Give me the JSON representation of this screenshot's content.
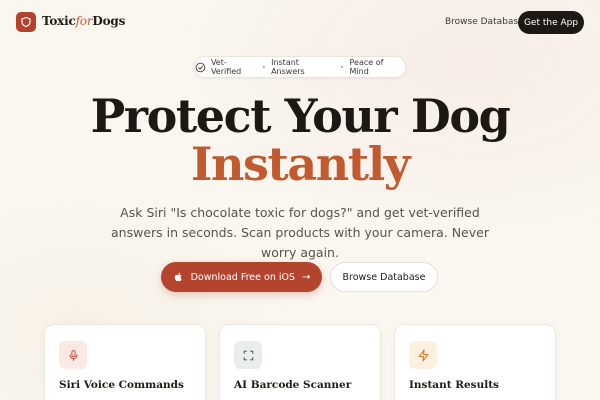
{
  "brand": {
    "name_part1": "Toxic",
    "name_part2": "for",
    "name_part3": "Dogs",
    "accent": "#b5422d"
  },
  "nav": {
    "link": "Browse Database",
    "cta": "Get the App"
  },
  "trust_pill": {
    "items": [
      "Vet-Verified",
      "Instant Answers",
      "Peace of Mind"
    ]
  },
  "hero": {
    "title_line1": "Protect Your Dog",
    "title_line2": "Instantly",
    "subtitle": "Ask Siri \"Is chocolate toxic for dogs?\" and get vet-verified answers in seconds. Scan products with your camera. Never worry again.",
    "primary_button": "Download Free on iOS",
    "secondary_button": "Browse Database"
  },
  "features": [
    {
      "title": "Siri Voice Commands",
      "icon": "microphone-icon",
      "tint": "#fbe9e5",
      "color": "#c4523c"
    },
    {
      "title": "AI Barcode Scanner",
      "icon": "scan-icon",
      "tint": "#e9eeeb",
      "color": "#4d5a55"
    },
    {
      "title": "Instant Results",
      "icon": "lightning-icon",
      "tint": "#fdf0e1",
      "color": "#d47a2a"
    }
  ]
}
